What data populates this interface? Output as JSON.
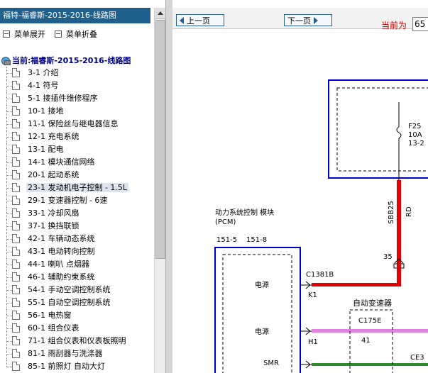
{
  "left_panel": {
    "title": "福特-福睿斯-2015-2016-线路图",
    "expand_label": "菜单展开",
    "collapse_label": "菜单折叠",
    "root_label": "当前:福睿斯-2015-2016-线路图",
    "items": [
      {
        "label": "3-1 介绍"
      },
      {
        "label": "4-1 符号"
      },
      {
        "label": "5-1 接插件维修程序"
      },
      {
        "label": "10-1 接地"
      },
      {
        "label": "11-1 保险丝与继电器信息"
      },
      {
        "label": "12-1 充电系统"
      },
      {
        "label": "13-1 配电"
      },
      {
        "label": "14-1 模块通信网络"
      },
      {
        "label": "20-1 起动系统"
      },
      {
        "label": "23-1 发动机电子控制 - 1.5L"
      },
      {
        "label": "29-1 变速器控制 - 6速"
      },
      {
        "label": "33-1 冷却风扇"
      },
      {
        "label": "37-1 换挡联锁"
      },
      {
        "label": "42-1 车辆动态系统"
      },
      {
        "label": "43-1 电动转向控制"
      },
      {
        "label": "44-1 喇叭 点烟器"
      },
      {
        "label": "46-1 辅助约束系统"
      },
      {
        "label": "54-1 手动空调控制系统"
      },
      {
        "label": "55-1 自动空调控制系统"
      },
      {
        "label": "56-1 电热窗"
      },
      {
        "label": "60-1 组合仪表"
      },
      {
        "label": "71-1 组合仪表和仪表板照明"
      },
      {
        "label": "81-1 雨刮器与洗涤器"
      },
      {
        "label": "85-1 前照灯 自动大灯"
      }
    ],
    "selected_index": 9
  },
  "toolbar": {
    "prev_label": "上一页",
    "next_label": "下一页",
    "current_label": "当前为",
    "page_value": "65"
  },
  "diagram": {
    "fuse_name": "F25",
    "fuse_rating": "10A",
    "fuse_loc": "13-2",
    "wire_code": "SBB25",
    "wire_color": "RD",
    "pcm_title": "动力系统控制 模块",
    "pcm_abbr": "(PCM)",
    "pcm_conn1": "151-5",
    "pcm_conn2": "151-8",
    "pin_35": "35",
    "conn_c1381b": "C1381B",
    "pin_k1": "K1",
    "pin_h1": "H1",
    "power1": "电源",
    "power2": "电源",
    "smr": "SMR",
    "trans_title": "自动变速器",
    "conn_c175e": "C175E",
    "pin_41": "41",
    "ce3": "CE3",
    "colors": {
      "red": "#e00000",
      "pink": "#e080e0",
      "green": "#2d8b2d",
      "blue": "#0000cc"
    }
  }
}
